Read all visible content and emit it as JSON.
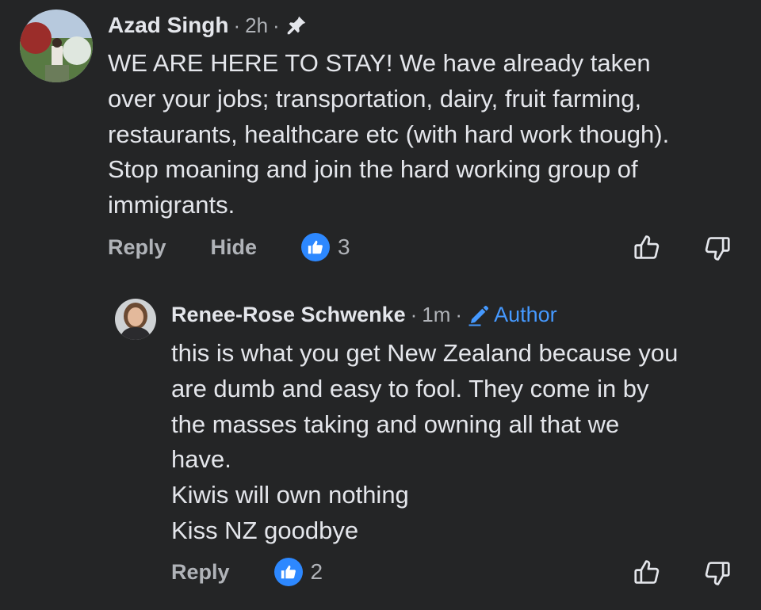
{
  "comments": [
    {
      "author": "Azad Singh",
      "time": "2h",
      "body": "WE ARE HERE TO STAY! We have already taken\nover your jobs; transportation, dairy, fruit farming,\nrestaurants, healthcare etc (with hard work though).\nStop moaning and join the hard working group of\nimmigrants.",
      "reply_label": "Reply",
      "hide_label": "Hide",
      "like_count": "3",
      "icons": [
        "pin-icon",
        "like-badge-icon",
        "thumbs-up-icon",
        "thumbs-down-icon"
      ]
    }
  ],
  "reply": {
    "author": "Renee-Rose Schwenke",
    "time": "1m",
    "author_badge": "Author",
    "body": "this is what you get New Zealand because you\nare dumb and easy to fool. They come in by\nthe masses taking and owning all that we\nhave.\nKiwis will own nothing\nKiss NZ goodbye",
    "reply_label": "Reply",
    "like_count": "2",
    "icons": [
      "pencil-icon",
      "like-badge-icon",
      "thumbs-up-icon",
      "thumbs-down-icon"
    ]
  },
  "colors": {
    "background": "#242526",
    "text_primary": "#e4e6eb",
    "text_secondary": "#b0b3b8",
    "accent_blue": "#2d88ff",
    "author_badge": "#4599ff"
  }
}
